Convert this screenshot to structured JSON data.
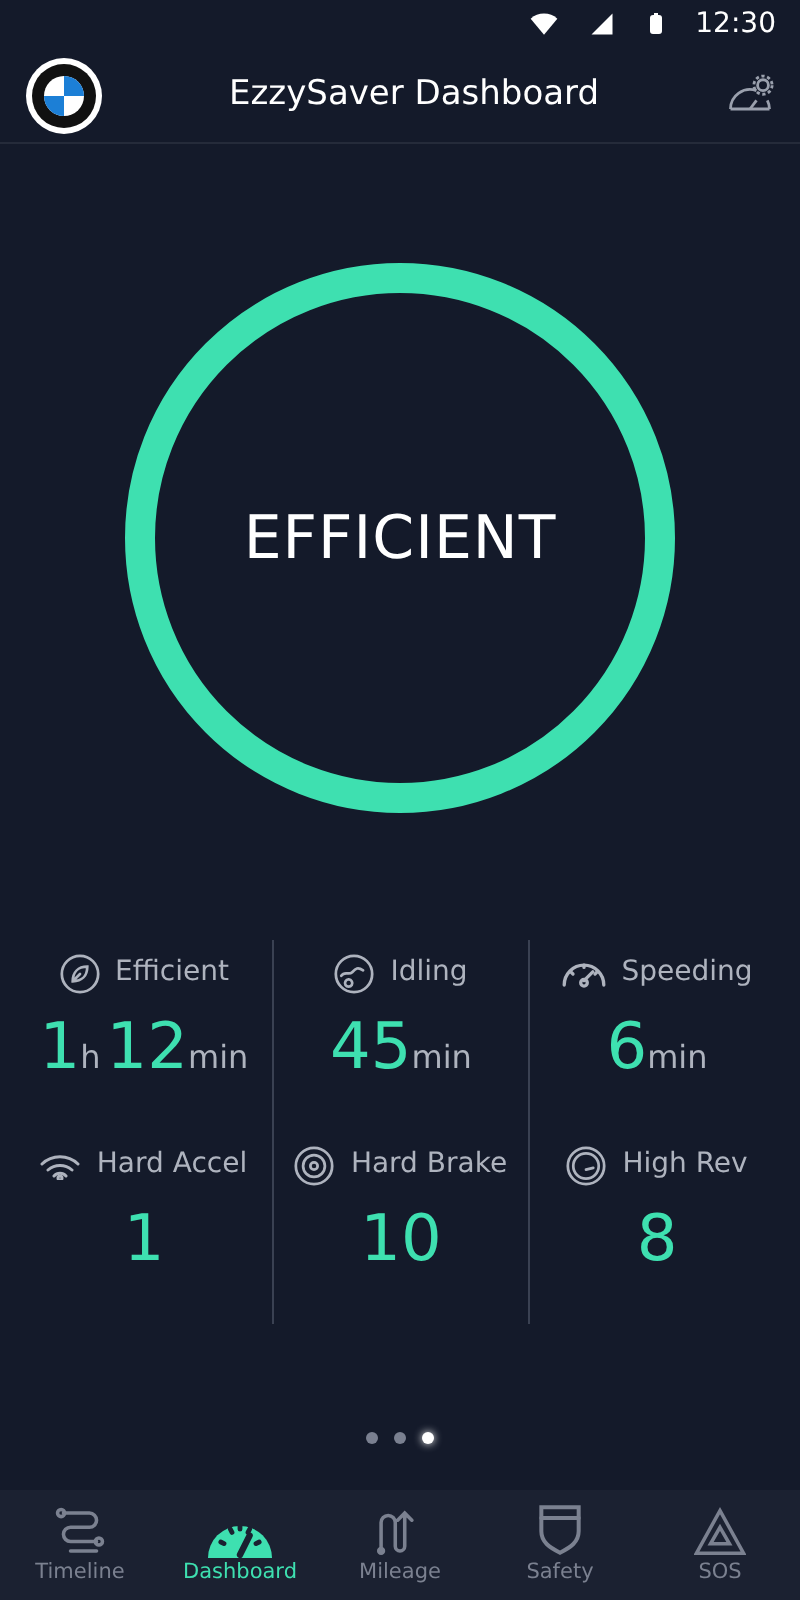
{
  "status_bar": {
    "time": "12:30"
  },
  "header": {
    "title": "EzzySaver Dashboard"
  },
  "gauge": {
    "label": "EFFICIENT",
    "level": 1
  },
  "stats": [
    {
      "label": "Efficient",
      "value": [
        {
          "text": "1",
          "kind": "number"
        },
        {
          "text": "h",
          "kind": "unit"
        },
        {
          "text": "12",
          "kind": "number"
        },
        {
          "text": "min",
          "kind": "unit"
        }
      ]
    },
    {
      "label": "Idling",
      "value": [
        {
          "text": "45",
          "kind": "number"
        },
        {
          "text": "min",
          "kind": "unit"
        }
      ]
    },
    {
      "label": "Speeding",
      "value": [
        {
          "text": "6",
          "kind": "number"
        },
        {
          "text": "min",
          "kind": "unit"
        }
      ]
    },
    {
      "label": "Hard Accel",
      "value": [
        {
          "text": "1",
          "kind": "number"
        }
      ]
    },
    {
      "label": "Hard Brake",
      "value": [
        {
          "text": "10",
          "kind": "number"
        }
      ]
    },
    {
      "label": "High Rev",
      "value": [
        {
          "text": "8",
          "kind": "number"
        }
      ]
    }
  ],
  "pager": [
    {
      "selected": false
    },
    {
      "selected": false
    },
    {
      "selected": true
    }
  ],
  "nav": [
    {
      "label": "Timeline",
      "selected": false
    },
    {
      "label": "Dashboard",
      "selected": true
    },
    {
      "label": "Mileage",
      "selected": false
    },
    {
      "label": "Safety",
      "selected": false
    },
    {
      "label": "SOS",
      "selected": false
    }
  ]
}
